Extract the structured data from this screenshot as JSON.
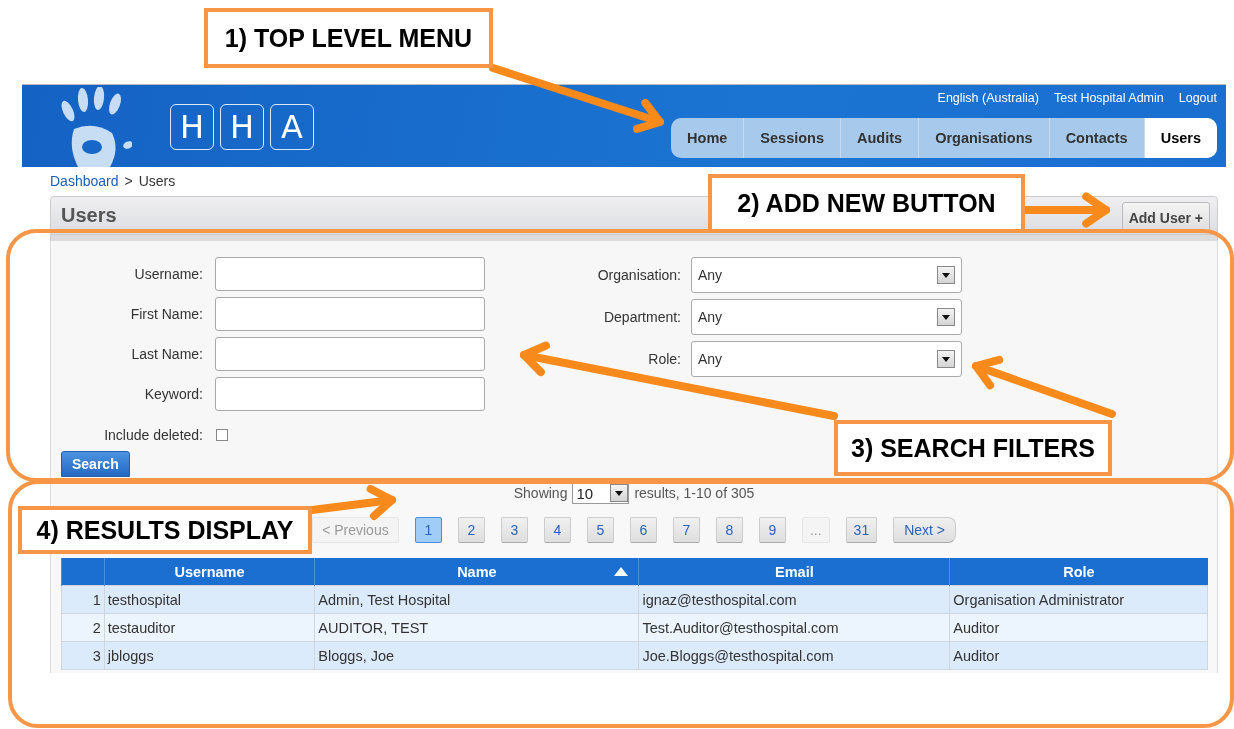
{
  "header": {
    "logo_letters": [
      "H",
      "H",
      "A"
    ],
    "links": [
      {
        "label": "English (Australia)"
      },
      {
        "label": "Test Hospital Admin"
      },
      {
        "label": "Logout"
      }
    ]
  },
  "nav": [
    {
      "label": "Home",
      "selected": false
    },
    {
      "label": "Sessions",
      "selected": false
    },
    {
      "label": "Audits",
      "selected": false
    },
    {
      "label": "Organisations",
      "selected": false
    },
    {
      "label": "Contacts",
      "selected": false
    },
    {
      "label": "Users",
      "selected": true
    }
  ],
  "breadcrumb": {
    "link": "Dashboard",
    "separator": ">",
    "current": "Users"
  },
  "panel": {
    "title": "Users",
    "add_button": "Add User +"
  },
  "filters": {
    "text_fields": [
      {
        "label": "Username:"
      },
      {
        "label": "First Name:"
      },
      {
        "label": "Last Name:"
      },
      {
        "label": "Keyword:"
      }
    ],
    "selects": [
      {
        "label": "Organisation:",
        "value": "Any"
      },
      {
        "label": "Department:",
        "value": "Any"
      },
      {
        "label": "Role:",
        "value": "Any"
      }
    ],
    "include_deleted": {
      "label": "Include deleted:",
      "checked": false
    },
    "search_button": "Search"
  },
  "results": {
    "showing_label": "Showing",
    "page_size": "10",
    "summary": "results, 1-10 of 305",
    "pages": [
      {
        "label": "< Previous",
        "kind": "prev",
        "selected": false,
        "disabled": true
      },
      {
        "label": "1",
        "kind": "page",
        "selected": true,
        "disabled": false
      },
      {
        "label": "2",
        "kind": "page",
        "selected": false,
        "disabled": false
      },
      {
        "label": "3",
        "kind": "page",
        "selected": false,
        "disabled": false
      },
      {
        "label": "4",
        "kind": "page",
        "selected": false,
        "disabled": false
      },
      {
        "label": "5",
        "kind": "page",
        "selected": false,
        "disabled": false
      },
      {
        "label": "6",
        "kind": "page",
        "selected": false,
        "disabled": false
      },
      {
        "label": "7",
        "kind": "page",
        "selected": false,
        "disabled": false
      },
      {
        "label": "8",
        "kind": "page",
        "selected": false,
        "disabled": false
      },
      {
        "label": "9",
        "kind": "page",
        "selected": false,
        "disabled": false
      },
      {
        "label": "...",
        "kind": "gap",
        "selected": false,
        "disabled": true
      },
      {
        "label": "31",
        "kind": "page",
        "selected": false,
        "disabled": false
      },
      {
        "label": "Next >",
        "kind": "next",
        "selected": false,
        "disabled": false
      }
    ],
    "table": {
      "columns": [
        {
          "label": "Username",
          "sorted": false
        },
        {
          "label": "Name",
          "sorted": true
        },
        {
          "label": "Email",
          "sorted": false
        },
        {
          "label": "Role",
          "sorted": false
        }
      ],
      "rows": [
        {
          "number": "1",
          "cells": [
            "testhospital",
            "Admin, Test Hospital",
            "ignaz@testhospital.com",
            "Organisation Administrator"
          ]
        },
        {
          "number": "2",
          "cells": [
            "testauditor",
            "AUDITOR, TEST",
            "Test.Auditor@testhospital.com",
            "Auditor"
          ]
        },
        {
          "number": "3",
          "cells": [
            "jbloggs",
            "Bloggs, Joe",
            "Joe.Bloggs@testhospital.com",
            "Auditor"
          ]
        }
      ]
    }
  },
  "annotations": [
    {
      "label": "1) TOP LEVEL MENU"
    },
    {
      "label": "2) ADD NEW BUTTON"
    },
    {
      "label": "3) SEARCH FILTERS"
    },
    {
      "label": "4) RESULTS DISPLAY"
    }
  ]
}
